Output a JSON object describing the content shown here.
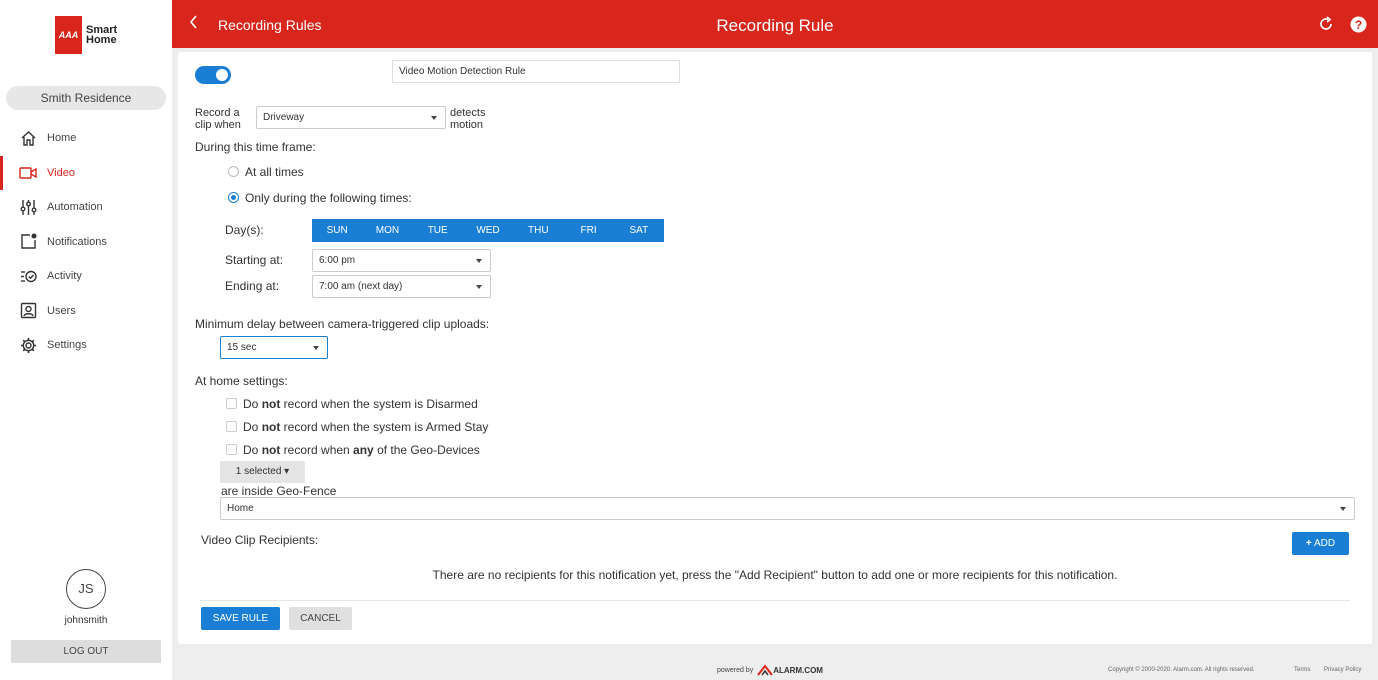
{
  "brand": {
    "logo_badge": "AAA",
    "logo_line1": "Smart",
    "logo_line2": "Home"
  },
  "sidebar": {
    "residence": "Smith Residence",
    "items": [
      {
        "label": "Home",
        "icon": "home-icon"
      },
      {
        "label": "Video",
        "icon": "video-camera-icon",
        "active": true
      },
      {
        "label": "Automation",
        "icon": "sliders-icon"
      },
      {
        "label": "Notifications",
        "icon": "notification-icon"
      },
      {
        "label": "Activity",
        "icon": "activity-icon"
      },
      {
        "label": "Users",
        "icon": "user-icon"
      },
      {
        "label": "Settings",
        "icon": "gear-icon"
      }
    ],
    "avatar_initials": "JS",
    "username": "johnsmith",
    "logout": "LOG OUT"
  },
  "header": {
    "back_label": "Recording Rules",
    "title": "Recording Rule",
    "accent": "#d9261c"
  },
  "rule": {
    "enabled": true,
    "name": "Video Motion Detection Rule",
    "record_line1": "Record a",
    "record_line2": "clip when",
    "camera": "Driveway",
    "detects_line1": "detects",
    "detects_line2": "motion",
    "time_frame_label": "During this time frame:",
    "option_all": "At all times",
    "option_following": "Only during the following times:",
    "selected_option": "following",
    "days_label": "Day(s):",
    "days": [
      "SUN",
      "MON",
      "TUE",
      "WED",
      "THU",
      "FRI",
      "SAT"
    ],
    "starting_label": "Starting at:",
    "starting_value": "6:00 pm",
    "ending_label": "Ending at:",
    "ending_value": "7:00 am (next day)",
    "delay_label": "Minimum delay between camera-triggered clip uploads:",
    "delay_value": "15 sec",
    "home_settings_label": "At home settings:",
    "check1": {
      "pre": "Do ",
      "bold": "not",
      "post": " record when the system is Disarmed"
    },
    "check2": {
      "pre": "Do ",
      "bold": "not",
      "post": " record when the system is Armed Stay"
    },
    "check3": {
      "pre": "Do ",
      "bold": "not",
      "mid": " record when ",
      "bold2": "any",
      "post": " of the Geo-Devices"
    },
    "geo_devices_selected": "1 selected",
    "inside_geofence": "are inside Geo-Fence",
    "geofence_value": "Home",
    "recipients_label": "Video Clip Recipients:",
    "add_button": "ADD",
    "empty_recipients": "There are no recipients for this notification yet, press the \"Add Recipient\" button to add one or more recipients for this notification.",
    "save_button": "SAVE RULE",
    "cancel_button": "CANCEL",
    "primary_color": "#1a7fd4"
  },
  "footer": {
    "powered_by": "powered by",
    "brand": "ALARM.COM",
    "copyright": "Copyright © 2000-2020. Alarm.com. All rights reserved.",
    "terms": "Terms",
    "privacy": "Privacy Policy"
  }
}
